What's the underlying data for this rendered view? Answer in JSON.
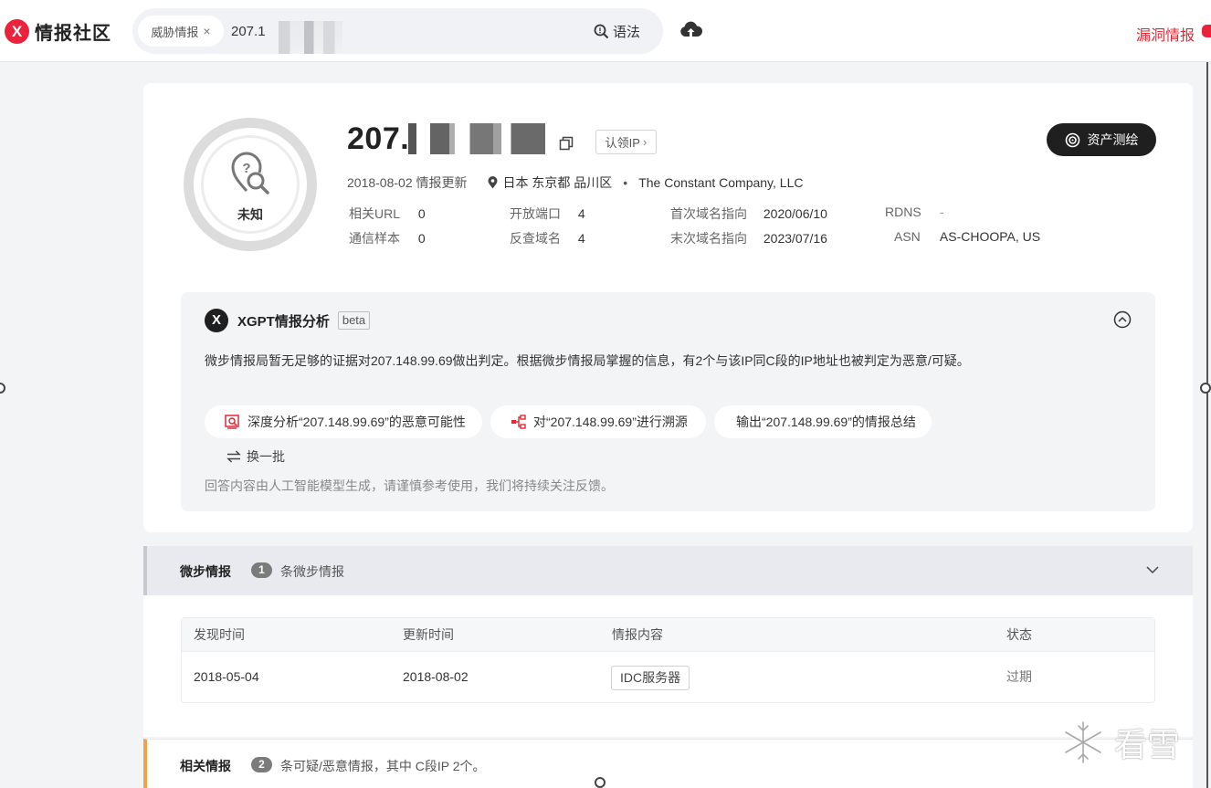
{
  "topbar": {
    "logo_mark": "X",
    "logo_text": "情报社区",
    "search_chip": "威胁情报",
    "search_chip_close": "×",
    "search_value": "207.1",
    "syntax_label": "语法",
    "vuln_link": "漏洞情报"
  },
  "summary": {
    "verdict": "未知",
    "ip_prefix": "207.",
    "claim_label": "认领IP",
    "claim_chevron": "›",
    "asset_button": "资产测绘",
    "updated": "2018-08-02 情报更新",
    "location": "日本 东京都 品川区",
    "separator": "•",
    "org": "The Constant Company, LLC",
    "stats": [
      {
        "label": "相关URL",
        "value": "0"
      },
      {
        "label": "开放端口",
        "value": "4"
      },
      {
        "label": "首次域名指向",
        "value": "2020/06/10"
      },
      {
        "label": "RDNS",
        "value": "-"
      },
      {
        "label": "通信样本",
        "value": "0"
      },
      {
        "label": "反查域名",
        "value": "4"
      },
      {
        "label": "末次域名指向",
        "value": "2023/07/16"
      },
      {
        "label": "ASN",
        "value": "AS-CHOOPA, US"
      }
    ]
  },
  "xgpt": {
    "logo_mark": "X",
    "title": "XGPT情报分析",
    "beta": "beta",
    "analysis": "微步情报局暂无足够的证据对207.148.99.69做出判定。根据微步情报局掌握的信息，有2个与该IP同C段的IP地址也被判定为恶意/可疑。",
    "suggestions": [
      "深度分析“207.148.99.69”的恶意可能性",
      "对“207.148.99.69”进行溯源",
      "输出“207.148.99.69”的情报总结"
    ],
    "refresh": "换一批",
    "disclaimer": "回答内容由人工智能模型生成，请谨慎参考使用，我们将持续关注反馈。"
  },
  "weibu_section": {
    "title": "微步情报",
    "count": "1",
    "desc": "条微步情报",
    "columns": [
      "发现时间",
      "更新时间",
      "情报内容",
      "状态"
    ],
    "rows": [
      {
        "found": "2018-05-04",
        "updated": "2018-08-02",
        "content": "IDC服务器",
        "status": "过期"
      }
    ]
  },
  "related_section": {
    "title": "相关情报",
    "count": "2",
    "desc": "条可疑/恶意情报，其中 C段IP 2个。"
  },
  "watermark": "看雪",
  "colors": {
    "brand_red": "#e8233b",
    "dark_button": "#1f1f1f",
    "related_accent": "#f0a14a"
  }
}
